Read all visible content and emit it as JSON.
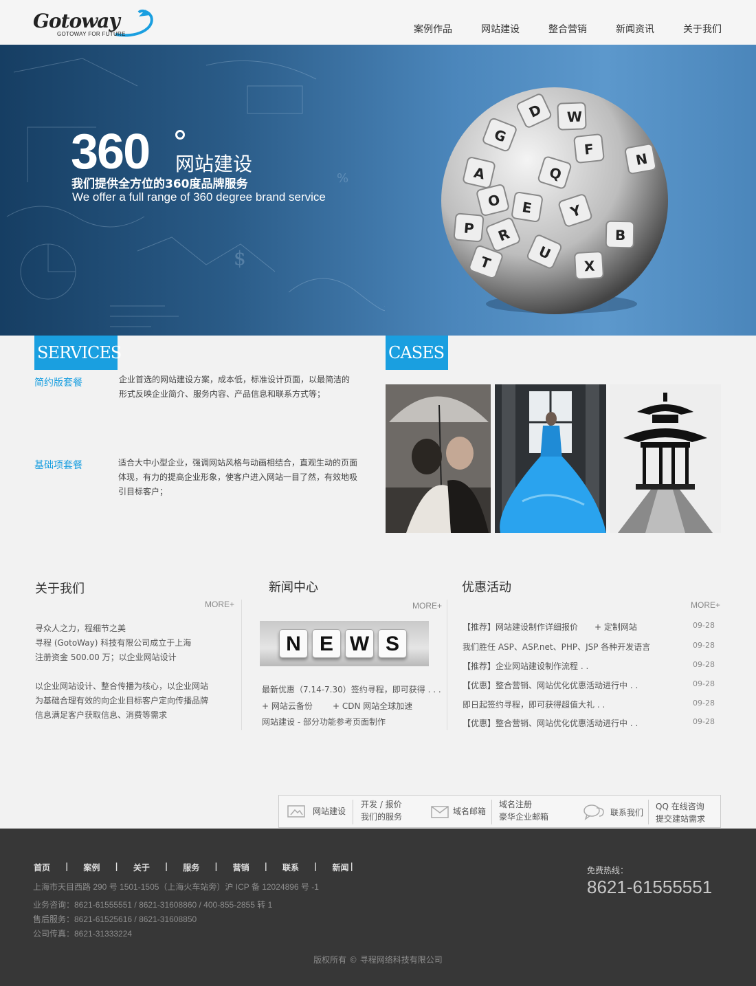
{
  "header": {
    "logo": "Gotoway",
    "logo_sub": "GOTOWAY FOR FUTURE",
    "nav": [
      "案例作品",
      "网站建设",
      "整合营销",
      "新闻资讯",
      "关于我们"
    ]
  },
  "banner": {
    "big": "360",
    "title": "网站建设",
    "sub_cn": "我们提供全方位的360度品牌服务",
    "sub_en": "We offer a full range of 360 degree brand service",
    "keys": [
      "D",
      "W",
      "G",
      "F",
      "Q",
      "N",
      "A",
      "O",
      "E",
      "Y",
      "P",
      "R",
      "B",
      "U",
      "X",
      "T"
    ]
  },
  "services": {
    "tag": "SERVICES",
    "items": [
      {
        "name": "简约版套餐",
        "desc": [
          "企业首选的网站建设方案，成本低，标准设计页面，以最简洁的",
          "形式反映企业简介、服务内容、产品信息和联系方式等；"
        ]
      },
      {
        "name": "基础项套餐",
        "desc": [
          "适合大中小型企业，强调网站风格与动画相结合，直观生动的页面",
          "体现，有力的提高企业形象，使客户进入网站一目了然，有效地吸",
          "引目标客户；"
        ]
      }
    ]
  },
  "cases": {
    "tag": "CASES"
  },
  "about": {
    "title": "关于我们",
    "more": "MORE+",
    "lines1": [
      "寻众人之力，程细节之美",
      "寻程 (GotoWay) 科技有限公司成立于上海",
      "注册资金 500.00 万；以企业网站设计"
    ],
    "lines2": [
      "以企业网站设计、整合传播为核心，以企业网站",
      "为基础合理有效的向企业目标客户定向传播品牌",
      "信息满足客户获取信息、消费等需求"
    ]
  },
  "news": {
    "title": "新闻中心",
    "more": "MORE+",
    "img_text": "NEWS",
    "line1": "最新优惠（7.14-7.30）签约寻程，即可获得 . . .",
    "line2a": "+ 网站云备份",
    "line2b": "+ CDN 网站全球加速",
    "line3": "网站建设 - 部分功能参考页面制作"
  },
  "promo": {
    "title": "优惠活动",
    "more": "MORE+",
    "items": [
      {
        "text": "【推荐】网站建设制作详细报价　　+ 定制网站",
        "date": "09-28"
      },
      {
        "text": "我们胜任 ASP、ASP.net、PHP、JSP 各种开发语言",
        "date": "09-28"
      },
      {
        "text": "【推荐】企业网站建设制作流程 . .",
        "date": "09-28"
      },
      {
        "text": "【优惠】整合营销、网站优化优惠活动进行中 . .",
        "date": "09-28"
      },
      {
        "text": "即日起签约寻程，即可获得超值大礼 . .",
        "date": "09-28"
      },
      {
        "text": "【优惠】整合营销、网站优化优惠活动进行中 . .",
        "date": "09-28"
      }
    ]
  },
  "svcbar": {
    "b1": "网站建设",
    "b2a": "开发 / 报价",
    "b2b": "我们的服务",
    "b3": "域名邮箱",
    "b4a": "域名注册",
    "b4b": "豪华企业邮箱",
    "b5": "联系我们",
    "b6a": "QQ 在线咨询",
    "b6b": "提交建站需求"
  },
  "footer": {
    "nav": [
      "首页",
      "案例",
      "关于",
      "服务",
      "营销",
      "联系",
      "新闻"
    ],
    "address": "上海市天目西路 290 号 1501-1505（上海火车站旁）沪 ICP 备 12024896 号 -1",
    "biz": "业务咨询：8621-61555551 / 8621-31608860 / 400-855-2855 转 1",
    "after": "售后服务：8621-61525616 / 8621-31608850",
    "fax": "公司传真：8621-31333224",
    "hot_label": "免费热线：",
    "hot_num": "8621-61555551",
    "copyright": "版权所有 © 寻程网络科技有限公司"
  }
}
